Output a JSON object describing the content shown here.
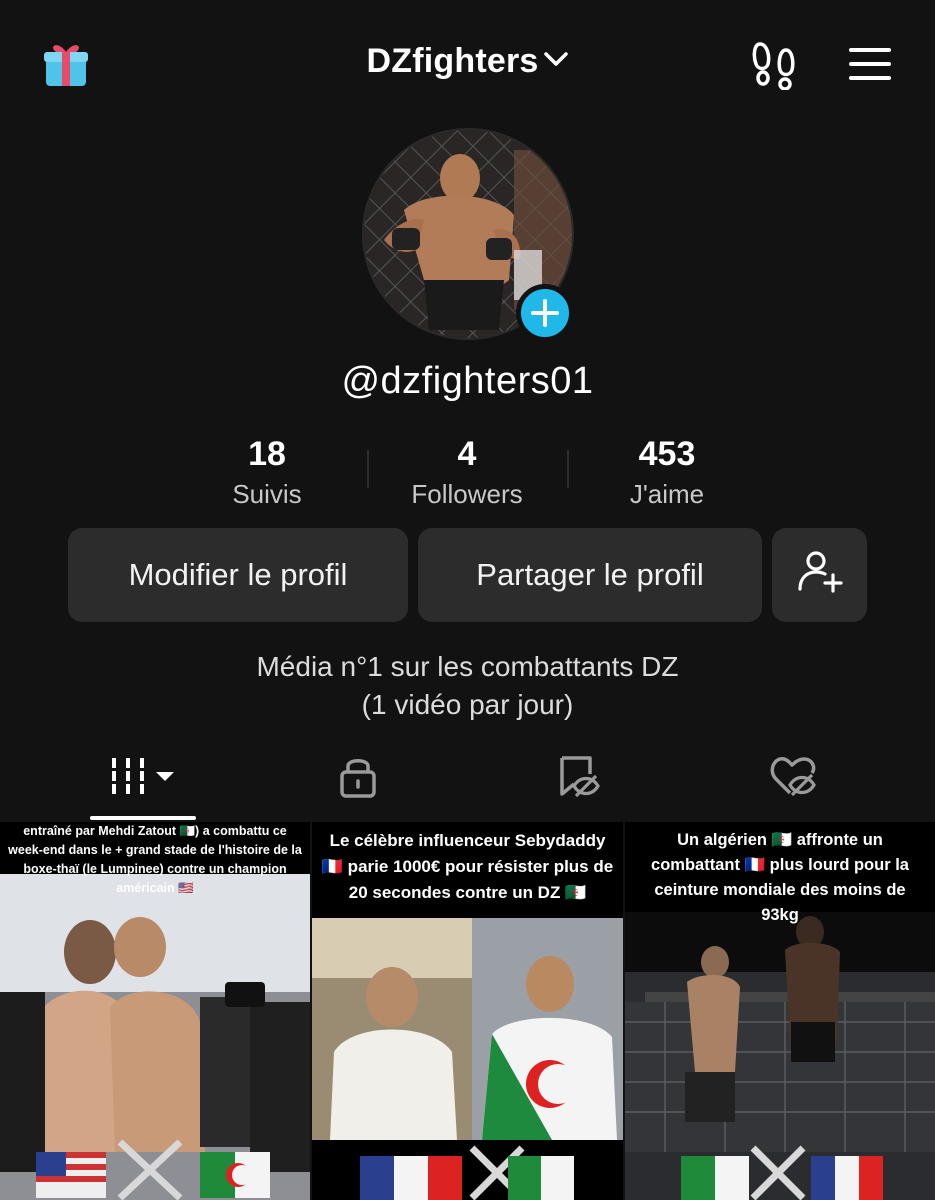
{
  "header": {
    "title": "DZfighters",
    "gift_icon": "gift-icon",
    "footprints_icon": "footprints-icon",
    "menu_icon": "hamburger-menu-icon"
  },
  "profile": {
    "handle": "@dzfighters01"
  },
  "stats": [
    {
      "value": "18",
      "label": "Suivis"
    },
    {
      "value": "4",
      "label": "Followers"
    },
    {
      "value": "453",
      "label": "J'aime"
    }
  ],
  "buttons": {
    "edit": "Modifier le profil",
    "share": "Partager le profil"
  },
  "bio": {
    "line1": "Média n°1 sur les combattants DZ",
    "line2": "(1 vidéo par jour)"
  },
  "tabs": [
    {
      "icon": "grid-videos-icon",
      "active": true
    },
    {
      "icon": "lock-icon",
      "active": false
    },
    {
      "icon": "bookmark-eye-icon",
      "active": false
    },
    {
      "icon": "heart-eye-icon",
      "active": false
    }
  ],
  "videos": [
    {
      "caption": "entraîné par Mehdi Zatout 🇩🇿) a combattu ce week-end dans le + grand stade de l'histoire de la boxe-thaï (le Lumpinee) contre un champion américain 🇺🇸"
    },
    {
      "caption": "Le célèbre influenceur Sebydaddy 🇫🇷 parie 1000€ pour résister plus de 20 secondes contre un DZ 🇩🇿"
    },
    {
      "caption": "Un algérien 🇩🇿 affronte un combattant 🇫🇷 plus lourd pour la ceinture mondiale des moins de 93kg"
    }
  ],
  "colors": {
    "background": "#121212",
    "button": "#2c2c2c",
    "accent": "#20b8e8"
  }
}
